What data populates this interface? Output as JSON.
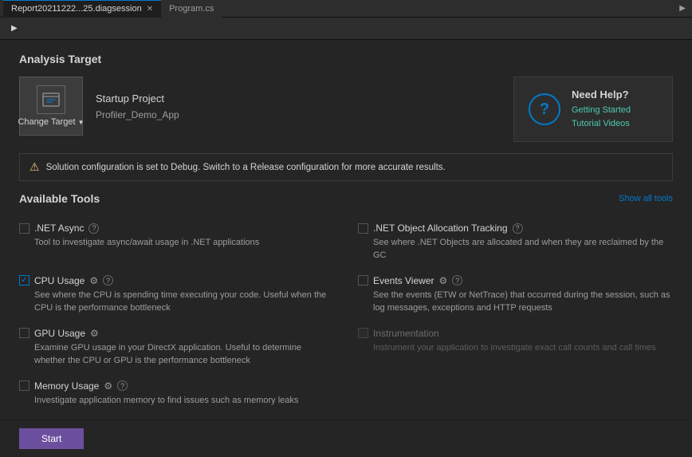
{
  "titlebar": {
    "tab1_label": "Report20211222...25.diagsession",
    "tab2_label": "Program.cs",
    "scroll_right": "▶"
  },
  "toolbar": {
    "arrow_label": "▶"
  },
  "analysis": {
    "section_title": "Analysis Target",
    "change_target_label": "Change",
    "target_label": "Target",
    "startup_project_heading": "Startup Project",
    "startup_project_value": "Profiler_Demo_App"
  },
  "help": {
    "title": "Need Help?",
    "link1": "Getting Started",
    "link2": "Tutorial Videos"
  },
  "warning": {
    "text": "Solution configuration is set to Debug. Switch to a Release configuration for more accurate results."
  },
  "tools": {
    "section_title": "Available Tools",
    "show_all": "Show all tools",
    "items": [
      {
        "id": "dotnet-async",
        "name": ".NET Async",
        "checked": false,
        "disabled": false,
        "has_info": true,
        "has_gear": false,
        "desc": "Tool to investigate async/await usage in .NET applications"
      },
      {
        "id": "dotnet-object-allocation",
        "name": ".NET Object Allocation Tracking",
        "checked": false,
        "disabled": false,
        "has_info": true,
        "has_gear": false,
        "desc": "See where .NET Objects are allocated and when they are reclaimed by the GC"
      },
      {
        "id": "cpu-usage",
        "name": "CPU Usage",
        "checked": true,
        "disabled": false,
        "has_info": true,
        "has_gear": true,
        "desc": "See where the CPU is spending time executing your code. Useful when the CPU is the performance bottleneck"
      },
      {
        "id": "events-viewer",
        "name": "Events Viewer",
        "checked": false,
        "disabled": false,
        "has_info": true,
        "has_gear": true,
        "desc": "See the events (ETW or NetTrace) that occurred during the session, such as log messages, exceptions and HTTP requests"
      },
      {
        "id": "gpu-usage",
        "name": "GPU Usage",
        "checked": false,
        "disabled": false,
        "has_info": false,
        "has_gear": true,
        "desc": "Examine GPU usage in your DirectX application. Useful to determine whether the CPU or GPU is the performance bottleneck"
      },
      {
        "id": "instrumentation",
        "name": "Instrumentation",
        "checked": false,
        "disabled": true,
        "has_info": false,
        "has_gear": false,
        "desc": "Instrument your application to investigate exact call counts and call times"
      },
      {
        "id": "memory-usage",
        "name": "Memory Usage",
        "checked": false,
        "disabled": false,
        "has_info": true,
        "has_gear": true,
        "desc": "Investigate application memory to find issues such as memory leaks"
      }
    ]
  },
  "bottom": {
    "start_label": "Start"
  }
}
